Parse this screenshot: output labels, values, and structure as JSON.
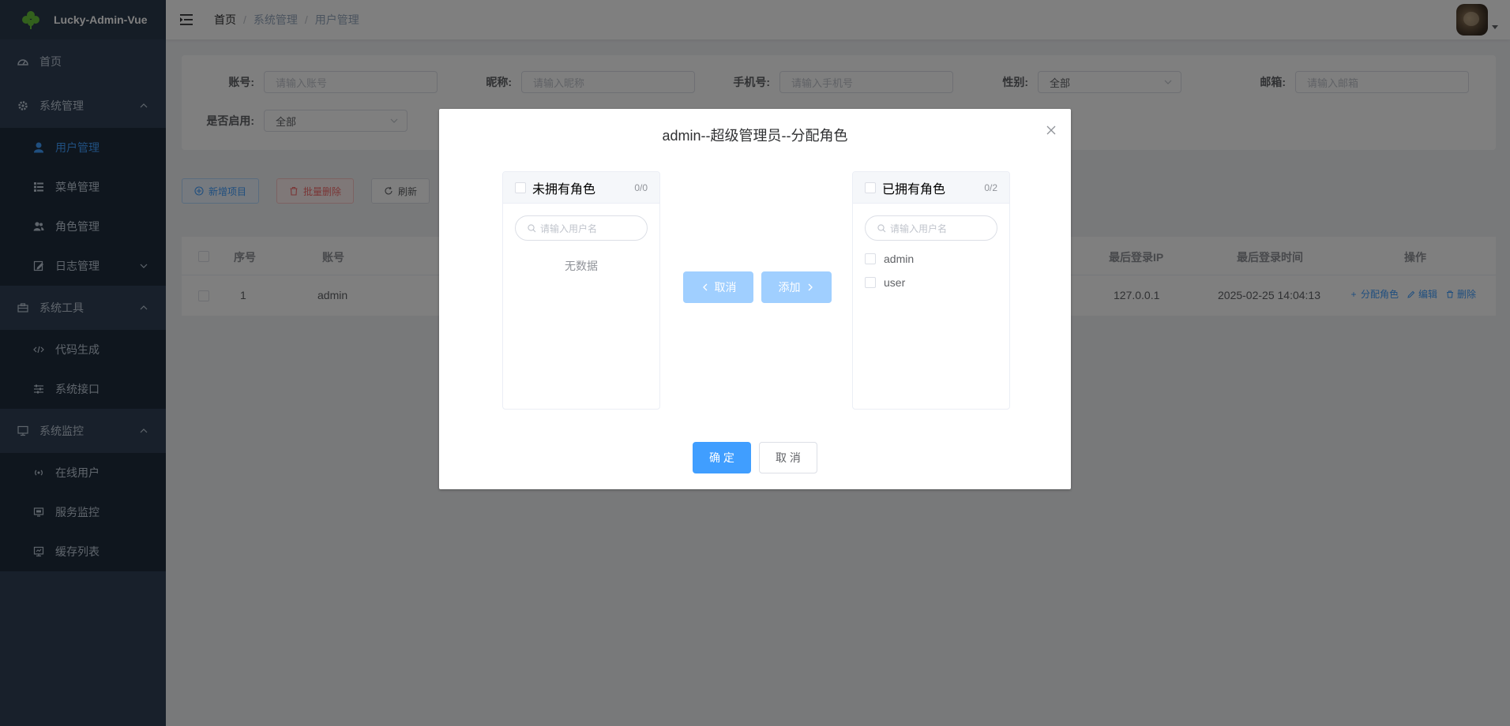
{
  "app": {
    "title": "Lucky-Admin-Vue"
  },
  "sidebar": {
    "items": [
      {
        "label": "首页",
        "icon": "dashboard-icon"
      },
      {
        "label": "系统管理",
        "icon": "gear-icon",
        "expanded": true,
        "children": [
          {
            "label": "用户管理",
            "icon": "user-icon",
            "active": true
          },
          {
            "label": "菜单管理",
            "icon": "list-icon"
          },
          {
            "label": "角色管理",
            "icon": "peoples-icon"
          },
          {
            "label": "日志管理",
            "icon": "log-icon"
          }
        ]
      },
      {
        "label": "系统工具",
        "icon": "toolbox-icon",
        "expanded": true,
        "children": [
          {
            "label": "代码生成",
            "icon": "code-icon"
          },
          {
            "label": "系统接口",
            "icon": "sliders-icon"
          }
        ]
      },
      {
        "label": "系统监控",
        "icon": "monitor-icon",
        "expanded": true,
        "children": [
          {
            "label": "在线用户",
            "icon": "online-icon"
          },
          {
            "label": "服务监控",
            "icon": "server-icon"
          },
          {
            "label": "缓存列表",
            "icon": "cache-icon"
          }
        ]
      }
    ]
  },
  "navbar": {
    "breadcrumb": [
      "首页",
      "系统管理",
      "用户管理"
    ]
  },
  "search": {
    "account": {
      "label": "账号:",
      "placeholder": "请输入账号"
    },
    "nickname": {
      "label": "昵称:",
      "placeholder": "请输入昵称"
    },
    "phone": {
      "label": "手机号:",
      "placeholder": "请输入手机号"
    },
    "gender": {
      "label": "性别:",
      "value": "全部"
    },
    "email": {
      "label": "邮箱:",
      "placeholder": "请输入邮箱"
    },
    "enabled": {
      "label": "是否启用:",
      "value": "全部"
    }
  },
  "toolbar": {
    "add": "新增项目",
    "batch_delete": "批量删除",
    "refresh": "刷新"
  },
  "table": {
    "headers": {
      "index": "序号",
      "account": "账号",
      "last_ip": "最后登录IP",
      "last_time": "最后登录时间",
      "actions": "操作"
    },
    "rows": [
      {
        "index": "1",
        "account": "admin",
        "last_ip": "127.0.0.1",
        "last_time": "2025-02-25 14:04:13"
      }
    ],
    "row_actions": {
      "assign": "分配角色",
      "edit": "编辑",
      "delete": "删除"
    }
  },
  "dialog": {
    "title": "admin--超级管理员--分配角色",
    "left": {
      "title": "未拥有角色",
      "count": "0/0",
      "placeholder": "请输入用户名",
      "empty": "无数据"
    },
    "right": {
      "title": "已拥有角色",
      "count": "0/2",
      "placeholder": "请输入用户名",
      "items": [
        "admin",
        "user"
      ]
    },
    "to_left": "取消",
    "to_right": "添加",
    "confirm": "确 定",
    "cancel": "取 消"
  },
  "colors": {
    "sidebar_bg": "#304156",
    "primary": "#409eff",
    "danger": "#f56c6c",
    "disabled_primary": "#a0cfff"
  }
}
